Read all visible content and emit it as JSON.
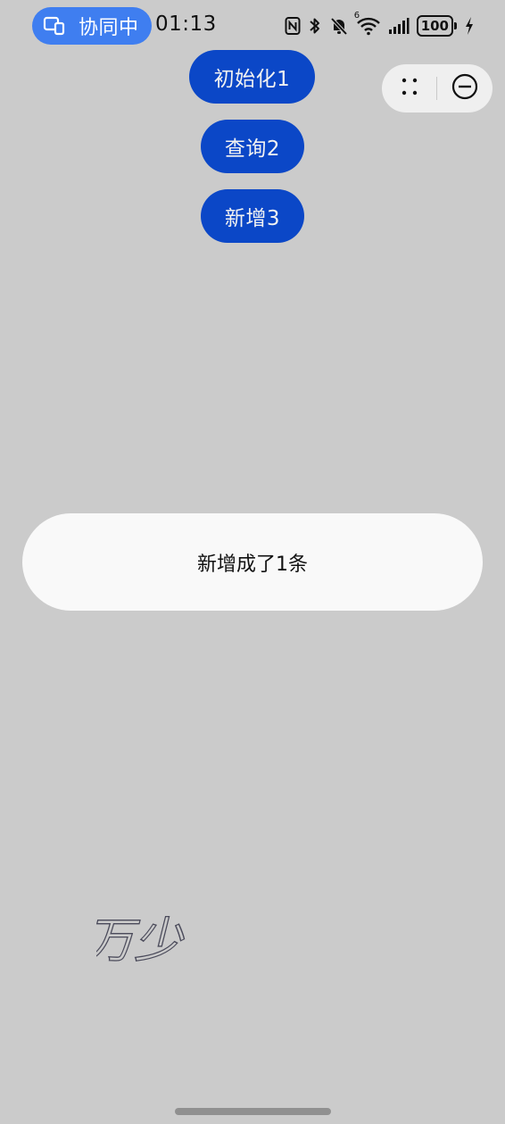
{
  "status_bar": {
    "collab_label": "协同中",
    "time": "01:13",
    "signal_badge": "6",
    "battery": "100"
  },
  "buttons": {
    "init": "初始化1",
    "query": "查询2",
    "add": "新增3"
  },
  "toast": {
    "message": "新增成了1条"
  },
  "watermark": {
    "text": "万少"
  },
  "colors": {
    "background": "#cbcbcb",
    "button": "#0b47c7",
    "collab_pill": "#3f7ef0",
    "toast": "#f9f9f9"
  },
  "icons": {
    "collab": "multi-device-icon",
    "nfc": "nfc-icon",
    "bluetooth": "bluetooth-icon",
    "mute": "bell-muted-icon",
    "wifi": "wifi-icon",
    "signal": "signal-icon",
    "charging": "charging-bolt-icon",
    "more": "more-dots-icon",
    "close": "close-circle-icon"
  }
}
